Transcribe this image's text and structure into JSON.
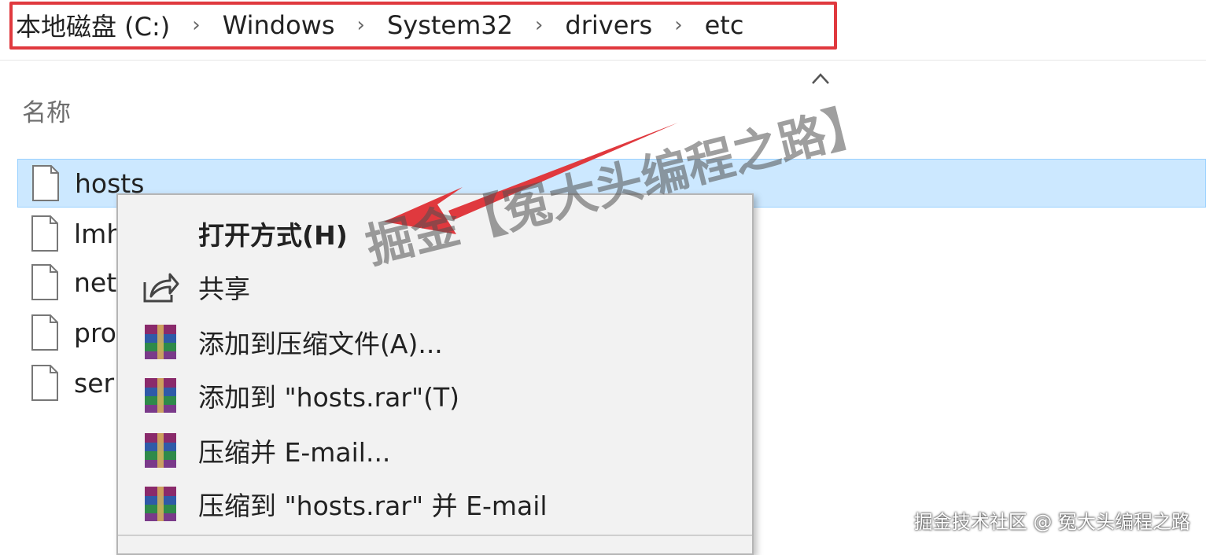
{
  "breadcrumb": {
    "items": [
      "本地磁盘 (C:)",
      "Windows",
      "System32",
      "drivers",
      "etc"
    ],
    "separator": "›"
  },
  "file_list": {
    "column_header": "名称",
    "files": [
      {
        "name": "hosts",
        "selected": true,
        "icon": "file-icon"
      },
      {
        "name": "lmh",
        "selected": false,
        "icon": "file-icon"
      },
      {
        "name": "net",
        "selected": false,
        "icon": "file-icon"
      },
      {
        "name": "pro",
        "selected": false,
        "icon": "file-icon"
      },
      {
        "name": "ser",
        "selected": false,
        "icon": "file-icon"
      }
    ]
  },
  "context_menu": {
    "items": [
      {
        "label": "打开方式(H)",
        "icon": "none",
        "bold": true
      },
      {
        "label": "共享",
        "icon": "share-icon",
        "bold": false
      },
      {
        "label": "添加到压缩文件(A)...",
        "icon": "winrar-icon",
        "bold": false
      },
      {
        "label": "添加到 \"hosts.rar\"(T)",
        "icon": "winrar-icon",
        "bold": false
      },
      {
        "label": "压缩并 E-mail...",
        "icon": "winrar-icon",
        "bold": false
      },
      {
        "label": "压缩到 \"hosts.rar\" 并 E-mail",
        "icon": "winrar-icon",
        "bold": false
      }
    ]
  },
  "watermark": "掘金【冤大头编程之路】",
  "footer_credit": "掘金技术社区 @ 冤大头编程之路",
  "colors": {
    "highlight_border": "#e0393e",
    "selection_bg": "#cce8ff",
    "arrow": "#e0393e"
  }
}
